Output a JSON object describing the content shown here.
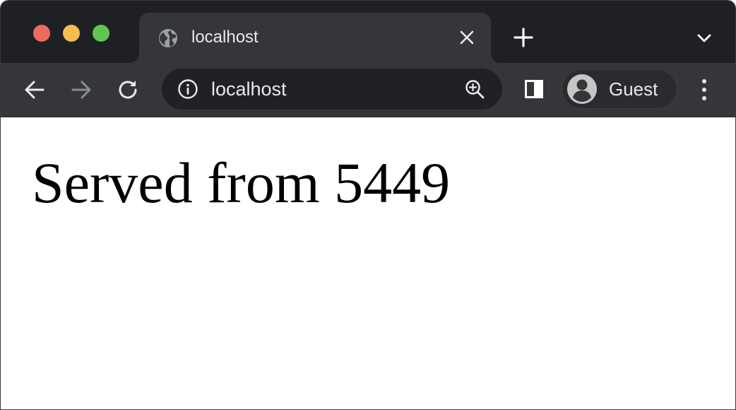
{
  "tab": {
    "title": "localhost",
    "favicon": "globe-icon"
  },
  "toolbar": {
    "back_icon": "arrow-left-icon",
    "forward_icon": "arrow-right-icon",
    "reload_icon": "reload-icon",
    "url": "localhost",
    "site_info_icon": "info-icon",
    "zoom_icon": "zoom-in-icon",
    "side_panel_icon": "side-panel-icon",
    "profile_label": "Guest",
    "menu_icon": "more-vertical-icon"
  },
  "page": {
    "heading": "Served from 5449"
  },
  "colors": {
    "tabstrip": "#1f2023",
    "active_tab": "#35363a",
    "omnibox": "#202124",
    "text_light": "#e8eaed",
    "close_dot": "#ed6a5e",
    "minimize_dot": "#f4bf4f",
    "maximize_dot": "#61c554"
  }
}
